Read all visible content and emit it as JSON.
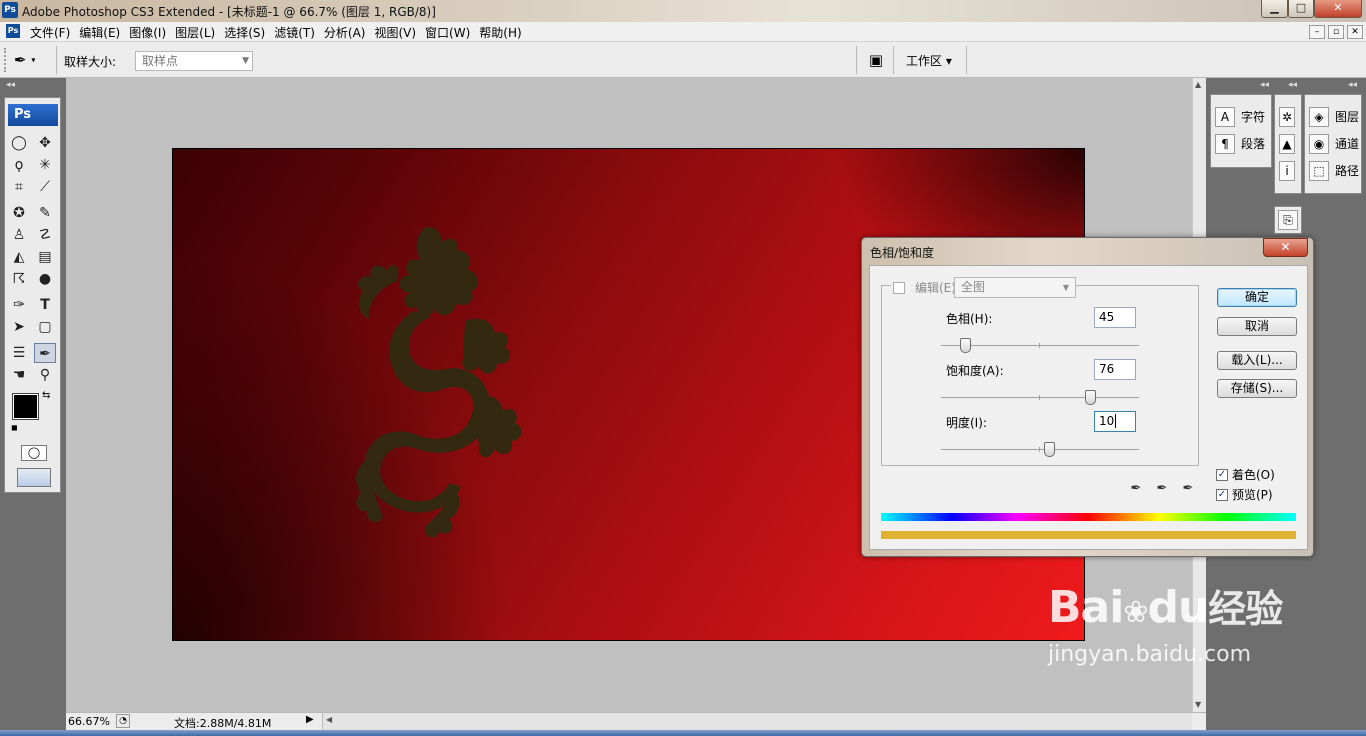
{
  "window": {
    "app_icon": "Ps",
    "title": "Adobe Photoshop CS3 Extended - [未标题-1 @ 66.7% (图层 1, RGB/8)]",
    "min_label": "▁",
    "max_label": "□",
    "close_label": "✕"
  },
  "menu": {
    "icon": "Ps",
    "items": [
      "文件(F)",
      "编辑(E)",
      "图像(I)",
      "图层(L)",
      "选择(S)",
      "滤镜(T)",
      "分析(A)",
      "视图(V)",
      "窗口(W)",
      "帮助(H)"
    ],
    "doc_min": "–",
    "doc_restore": "▫",
    "doc_close": "✕"
  },
  "options": {
    "sample_size_label": "取样大小:",
    "sample_size_value": "取样点",
    "workspace_label": "工作区 ▾"
  },
  "toolbox": {
    "logo": "Ps",
    "collapse": "◂◂"
  },
  "panels": {
    "collapse": "◂◂",
    "group1": [
      {
        "icon": "A",
        "label": "字符"
      },
      {
        "icon": "¶",
        "label": "段落"
      }
    ],
    "group2": [
      {
        "icon": "✲",
        "label": ""
      },
      {
        "icon": "▲",
        "label": ""
      },
      {
        "icon": "i",
        "label": ""
      }
    ],
    "group3": [
      {
        "icon": "◈",
        "label": "图层"
      },
      {
        "icon": "◉",
        "label": "通道"
      },
      {
        "icon": "⬚",
        "label": "路径"
      }
    ]
  },
  "status": {
    "zoom": "66.67%",
    "doc_info": "文档:2.88M/4.81M"
  },
  "dialog": {
    "title": "色相/饱和度",
    "close": "✕",
    "edit_label": "编辑(E):",
    "edit_value": "全图",
    "hue_label": "色相(H):",
    "hue_value": "45",
    "saturation_label": "饱和度(A):",
    "saturation_value": "76",
    "lightness_label": "明度(I):",
    "lightness_value": "10",
    "ok": "确定",
    "cancel": "取消",
    "load": "载入(L)...",
    "save": "存储(S)...",
    "colorize_label": "着色(O)",
    "colorize_checked": true,
    "preview_label": "预览(P)",
    "preview_checked": true,
    "hue_fraction": 0.125,
    "saturation_fraction": 0.76,
    "lightness_fraction": 0.55
  },
  "watermark": {
    "brand": "Bai",
    "brand2": "du",
    "suffix": "经验",
    "url": "jingyan.baidu.com"
  }
}
